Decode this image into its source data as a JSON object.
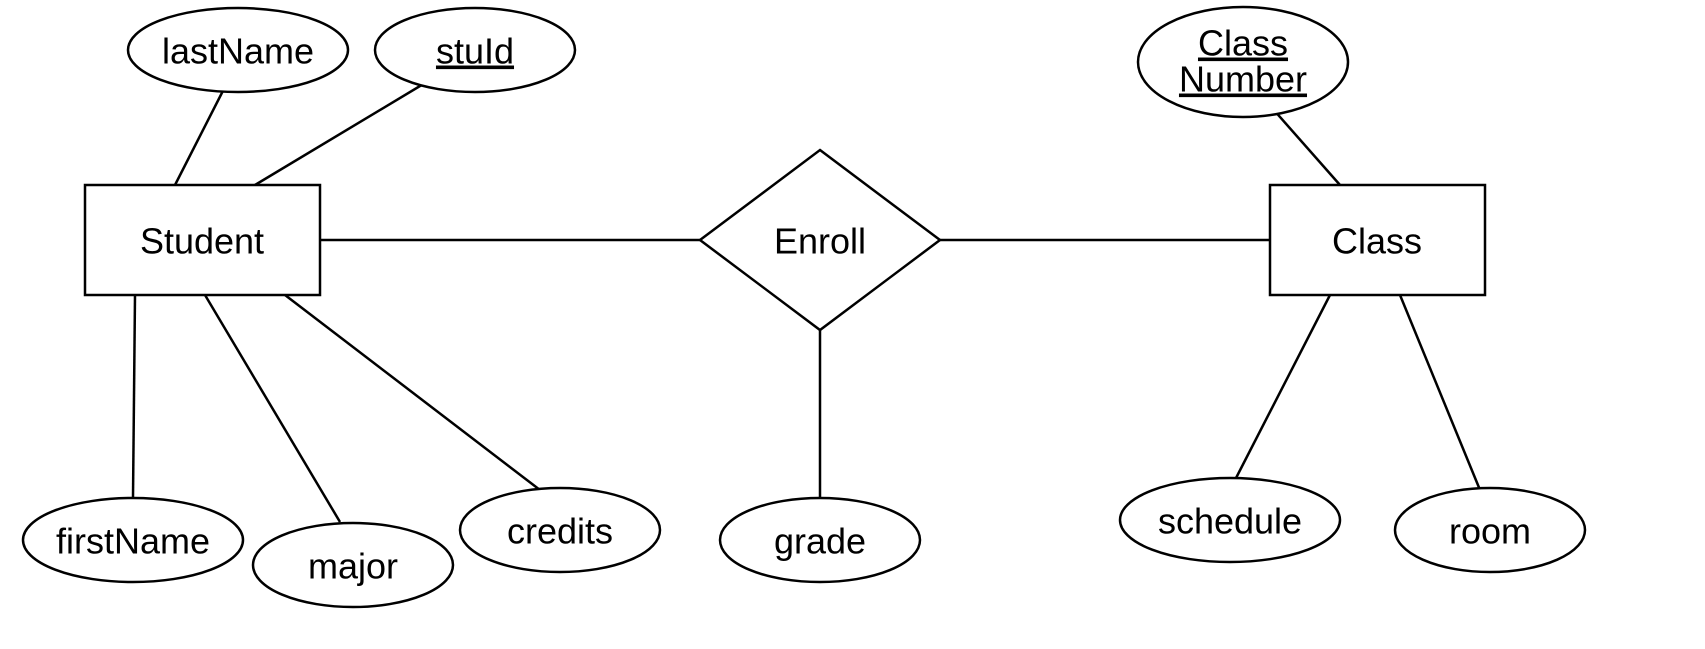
{
  "entities": {
    "student": {
      "label": "Student"
    },
    "class": {
      "label": "Class"
    }
  },
  "relationship": {
    "enroll": {
      "label": "Enroll"
    }
  },
  "attributes": {
    "student_lastName": {
      "label": "lastName",
      "key": false
    },
    "student_stuId": {
      "label": "stuId",
      "key": true
    },
    "student_firstName": {
      "label": "firstName",
      "key": false
    },
    "student_major": {
      "label": "major",
      "key": false
    },
    "student_credits": {
      "label": "credits",
      "key": false
    },
    "enroll_grade": {
      "label": "grade",
      "key": false
    },
    "class_classNumber_line1": {
      "label": "Class",
      "key": true
    },
    "class_classNumber_line2": {
      "label": "Number",
      "key": true
    },
    "class_schedule": {
      "label": "schedule",
      "key": false
    },
    "class_room": {
      "label": "room",
      "key": false
    }
  }
}
